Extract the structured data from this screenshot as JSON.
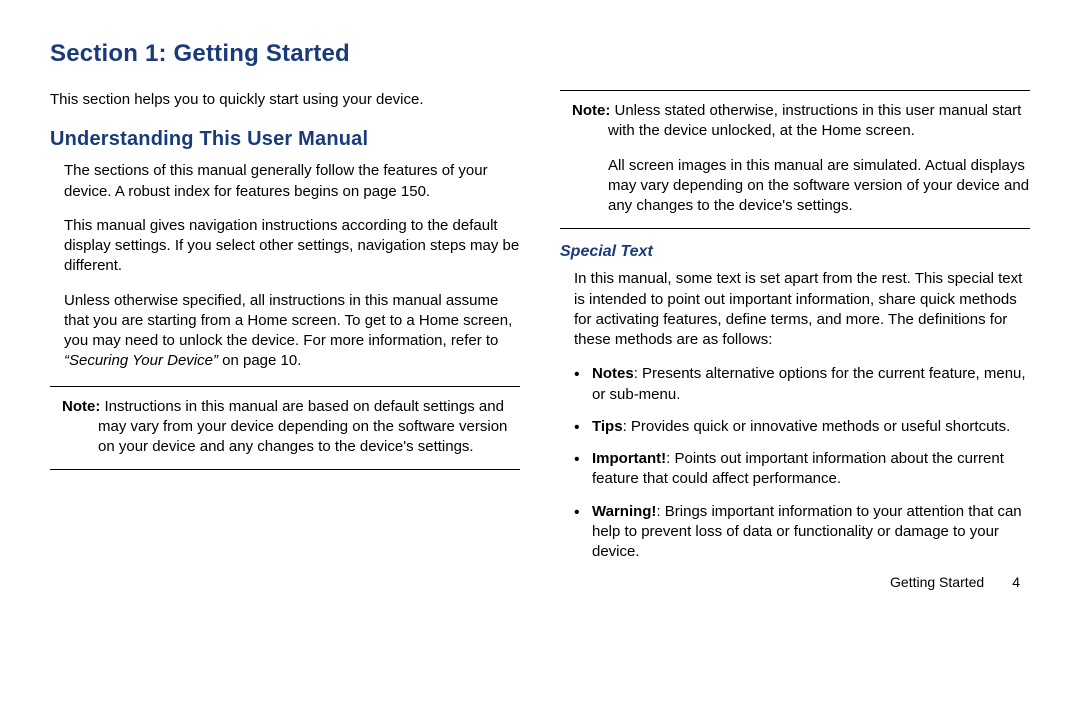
{
  "section_title": "Section 1: Getting Started",
  "intro": "This section helps you to quickly start using your device.",
  "left": {
    "h2": "Understanding This User Manual",
    "p1": "The sections of this manual generally follow the features of your device. A robust index for features begins on page 150.",
    "p2": "This manual gives navigation instructions according to the default display settings. If you select other settings, navigation steps may be different.",
    "p3_a": "Unless otherwise specified, all instructions in this manual assume that you are starting from a Home screen. To get to a Home screen, you may need to unlock the device. For more information, refer to ",
    "p3_ref": "“Securing Your Device”",
    "p3_b": " on page 10.",
    "note_label": "Note:",
    "note_text": " Instructions in this manual are based on default settings and may vary from your device depending on the software version on your device and any changes to the device's settings."
  },
  "right": {
    "note_label": "Note:",
    "note_text": " Unless stated otherwise, instructions in this user manual start with the device unlocked, at the Home screen.",
    "note_p2": "All screen images in this manual are simulated. Actual displays may vary depending on the software version of your device and any changes to the device's settings.",
    "special_h": "Special Text",
    "special_intro": "In this manual, some text is set apart from the rest. This special text is intended to point out important information, share quick methods for activating features, define terms, and more. The definitions for these methods are as follows:",
    "items": [
      {
        "label": "Notes",
        "text": ": Presents alternative options for the current feature, menu, or sub-menu."
      },
      {
        "label": "Tips",
        "text": ": Provides quick or innovative methods or useful shortcuts."
      },
      {
        "label": "Important!",
        "text": ": Points out important information about the current feature that could affect performance."
      },
      {
        "label": "Warning!",
        "text": ": Brings important information to your attention that can help to prevent loss of data or functionality or damage to your device."
      }
    ]
  },
  "footer": {
    "label": "Getting Started",
    "page": "4"
  }
}
